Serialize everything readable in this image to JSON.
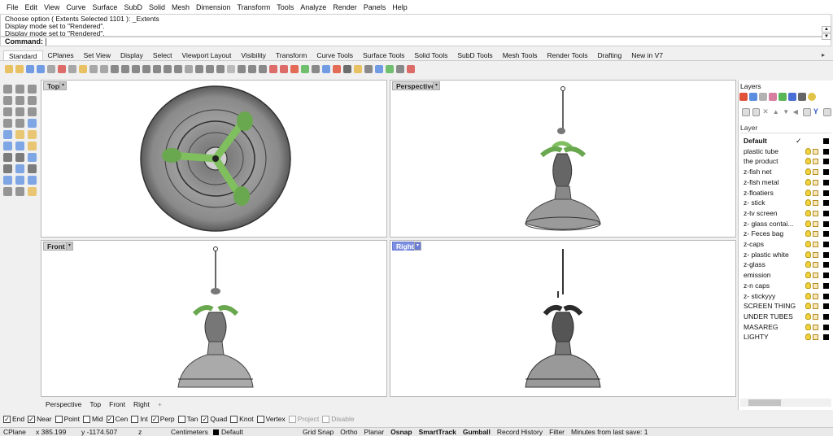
{
  "menu": [
    "File",
    "Edit",
    "View",
    "Curve",
    "Surface",
    "SubD",
    "Solid",
    "Mesh",
    "Dimension",
    "Transform",
    "Tools",
    "Analyze",
    "Render",
    "Panels",
    "Help"
  ],
  "history": [
    "Choose option ( Extents  Selected  1101 ): _Extents",
    "Display mode set to \"Rendered\".",
    "Display mode set to \"Rendered\"."
  ],
  "command_label": "Command:",
  "tabs": [
    "Standard",
    "CPlanes",
    "Set View",
    "Display",
    "Select",
    "Viewport Layout",
    "Visibility",
    "Transform",
    "Curve Tools",
    "Surface Tools",
    "Solid Tools",
    "SubD Tools",
    "Mesh Tools",
    "Render Tools",
    "Drafting",
    "New in V7"
  ],
  "viewports": {
    "top": "Top",
    "perspective": "Perspective",
    "front": "Front",
    "right": "Right"
  },
  "viewport_tabs": [
    "Perspective",
    "Top",
    "Front",
    "Right"
  ],
  "viewport_tab_add": "+",
  "osnaps": [
    {
      "label": "End",
      "checked": true
    },
    {
      "label": "Near",
      "checked": true
    },
    {
      "label": "Point",
      "checked": false
    },
    {
      "label": "Mid",
      "checked": false
    },
    {
      "label": "Cen",
      "checked": true
    },
    {
      "label": "Int",
      "checked": false
    },
    {
      "label": "Perp",
      "checked": true
    },
    {
      "label": "Tan",
      "checked": false
    },
    {
      "label": "Quad",
      "checked": true
    },
    {
      "label": "Knot",
      "checked": false
    },
    {
      "label": "Vertex",
      "checked": false
    },
    {
      "label": "Project",
      "checked": false,
      "disabled": true
    },
    {
      "label": "Disable",
      "checked": false,
      "disabled": true
    }
  ],
  "status": {
    "cplane": "CPlane",
    "x": "x 385.199",
    "y": "y -1174.507",
    "z": "z",
    "units": "Centimeters",
    "layer": "Default",
    "grid_snap": "Grid Snap",
    "ortho": "Ortho",
    "planar": "Planar",
    "osnap": "Osnap",
    "smarttrack": "SmartTrack",
    "gumball": "Gumball",
    "record_history": "Record History",
    "filter": "Filter",
    "save": "Minutes from last save: 1"
  },
  "layers": {
    "title": "Layers",
    "header": "Layer",
    "current_mark": "✓",
    "items": [
      "Default",
      "plastic tube",
      "the product",
      "z-fish net",
      "z-fish metal",
      "z-floatiers",
      "z- stick",
      "z-tv screen",
      "z- glass contai...",
      "z- Feces bag",
      "z-caps",
      "z- plastic white",
      "z-glass",
      "emission",
      "z-n caps",
      "z- stickyyy",
      "SCREEN THING",
      "UNDER TUBES",
      "MASAREG",
      "LIGHTY"
    ]
  },
  "colors": {
    "accent": "#7d8fe0",
    "green": "#7fbf5e",
    "dark": "#2a2a2a"
  }
}
